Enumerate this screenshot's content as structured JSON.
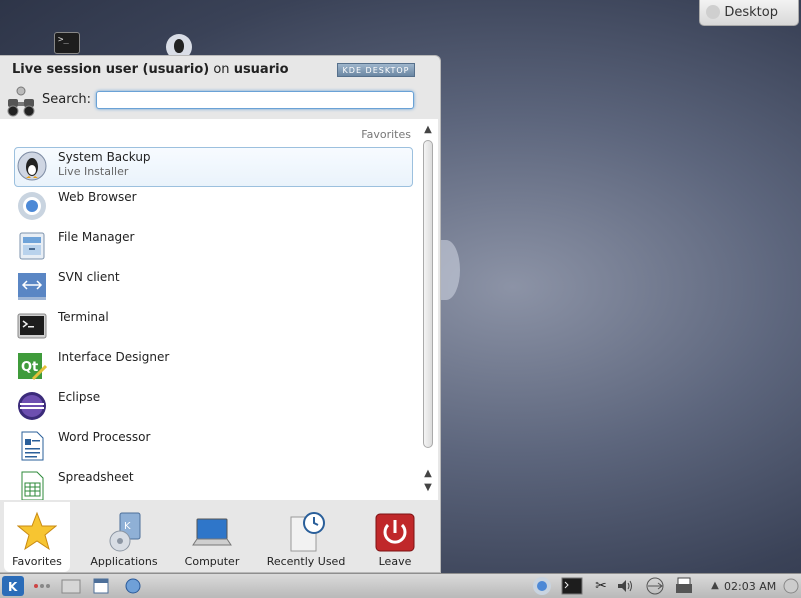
{
  "desktop_button": {
    "label": "Desktop"
  },
  "launcher": {
    "user_name": "Live session user (usuario)",
    "on_word": "on",
    "host": "usuario",
    "brand_badge": "KDE DESKTOP",
    "search": {
      "label": "Search:",
      "value": "",
      "placeholder": ""
    },
    "favorites_header": "Favorites",
    "favorites": [
      {
        "name": "System Backup",
        "subtitle": "Live Installer",
        "icon": "penguin-icon",
        "selected": true
      },
      {
        "name": "Web Browser",
        "subtitle": "",
        "icon": "browser-icon"
      },
      {
        "name": "File Manager",
        "subtitle": "",
        "icon": "file-manager-icon"
      },
      {
        "name": "SVN client",
        "subtitle": "",
        "icon": "svn-icon"
      },
      {
        "name": "Terminal",
        "subtitle": "",
        "icon": "terminal-icon"
      },
      {
        "name": "Interface Designer",
        "subtitle": "",
        "icon": "qt-designer-icon"
      },
      {
        "name": "Eclipse",
        "subtitle": "",
        "icon": "eclipse-icon"
      },
      {
        "name": "Word Processor",
        "subtitle": "",
        "icon": "word-processor-icon"
      },
      {
        "name": "Spreadsheet",
        "subtitle": "",
        "icon": "spreadsheet-icon"
      }
    ],
    "tabs": [
      {
        "label": "Favorites",
        "icon": "star-icon",
        "active": true
      },
      {
        "label": "Applications",
        "icon": "applications-icon"
      },
      {
        "label": "Computer",
        "icon": "computer-icon"
      },
      {
        "label": "Recently Used",
        "icon": "clock-icon"
      },
      {
        "label": "Leave",
        "icon": "power-icon"
      }
    ]
  },
  "taskbar": {
    "clock": "02:03 AM",
    "icons": [
      "kde-menu-icon",
      "pager-icon",
      "show-desktop-icon",
      "calendar-icon",
      "network-globe-icon",
      "browser-icon",
      "terminal-icon",
      "scissors-icon",
      "volume-icon",
      "usb-icon",
      "printer-icon",
      "arrow-up-icon"
    ]
  },
  "colors": {
    "accent": "#6aa2d6",
    "leave": "#c0282a",
    "desktop_bg": "#4a5268"
  }
}
